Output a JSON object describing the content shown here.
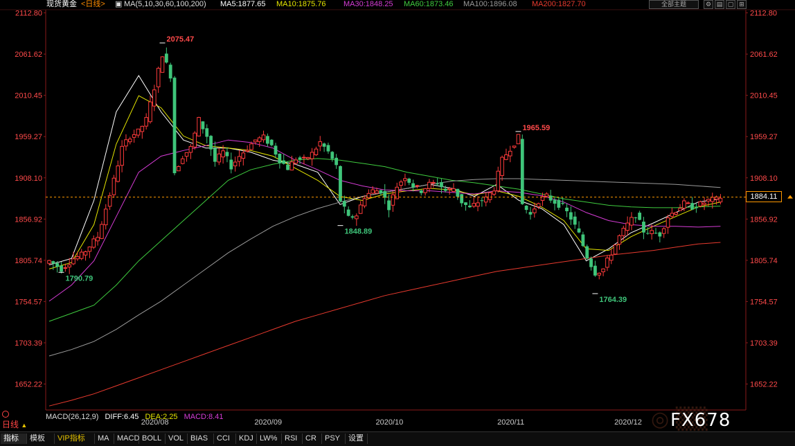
{
  "header": {
    "instrument": "现货黄金",
    "period_tag": "<日线>",
    "ma_group": "MA(5,10,30,60,100,200)",
    "ma5": "MA5:1877.65",
    "ma10": "MA10:1875.76",
    "ma30": "MA30:1848.25",
    "ma60": "MA60:1873.46",
    "ma100": "MA100:1896.08",
    "ma200": "MA200:1827.70",
    "all_button": "全部主题"
  },
  "colors": {
    "up": "#ff3b3b",
    "down": "#3fc57a",
    "ma5": "#ffffff",
    "ma10": "#e6e600",
    "ma30": "#d63cd6",
    "ma60": "#3fcc3f",
    "ma100": "#9a9a9a",
    "ma200": "#e83a2e",
    "price_line": "#ff9900"
  },
  "price_tag": "1884.11",
  "macd": {
    "title": "MACD(26,12,9)",
    "diff": "DIFF:6.45",
    "dea": "DEA:2.25",
    "macd": "MACD:8.41"
  },
  "period_label": "日线",
  "toolbar": [
    "指标",
    "模板",
    "VIP指标",
    "MA",
    "MACD",
    "BOLL",
    "VOL",
    "BIAS",
    "CCI",
    "KDJ",
    "LW%",
    "RSI",
    "CR",
    "PSY",
    "设置"
  ],
  "watermark": "FX678",
  "chart_data": {
    "type": "candlestick",
    "title": "",
    "ylim": [
      1620,
      2115
    ],
    "y_ticks": [
      "2112.80",
      "2061.62",
      "2010.45",
      "1959.27",
      "1908.10",
      "1856.92",
      "1805.74",
      "1754.57",
      "1703.39",
      "1652.22"
    ],
    "x_labels": [
      "2020/08",
      "2020/09",
      "2020/10",
      "2020/11",
      "2020/12"
    ],
    "annotations": [
      {
        "text": "2075.47",
        "index": 28,
        "value": 2075.47,
        "type": "high"
      },
      {
        "text": "1965.59",
        "index": 116,
        "value": 1965.59,
        "type": "high"
      },
      {
        "text": "1848.89",
        "index": 72,
        "value": 1848.89,
        "type": "low"
      },
      {
        "text": "1790.79",
        "index": 3,
        "value": 1790.79,
        "type": "low"
      },
      {
        "text": "1764.39",
        "index": 135,
        "value": 1764.39,
        "type": "low"
      }
    ],
    "current_price": 1884.11,
    "anchors": [
      [
        0,
        1805
      ],
      [
        3,
        1795
      ],
      [
        6,
        1808
      ],
      [
        8,
        1812
      ],
      [
        12,
        1835
      ],
      [
        14,
        1870
      ],
      [
        16,
        1905
      ],
      [
        18,
        1945
      ],
      [
        20,
        1960
      ],
      [
        22,
        1965
      ],
      [
        24,
        1980
      ],
      [
        26,
        2020
      ],
      [
        28,
        2062
      ],
      [
        30,
        2035
      ],
      [
        31,
        1915
      ],
      [
        33,
        1935
      ],
      [
        35,
        1945
      ],
      [
        37,
        1980
      ],
      [
        39,
        1960
      ],
      [
        41,
        1928
      ],
      [
        43,
        1940
      ],
      [
        45,
        1922
      ],
      [
        47,
        1935
      ],
      [
        49,
        1945
      ],
      [
        51,
        1955
      ],
      [
        53,
        1958
      ],
      [
        55,
        1948
      ],
      [
        57,
        1930
      ],
      [
        59,
        1920
      ],
      [
        61,
        1932
      ],
      [
        63,
        1930
      ],
      [
        65,
        1938
      ],
      [
        67,
        1952
      ],
      [
        69,
        1940
      ],
      [
        71,
        1922
      ],
      [
        72,
        1880
      ],
      [
        74,
        1858
      ],
      [
        76,
        1862
      ],
      [
        78,
        1885
      ],
      [
        80,
        1892
      ],
      [
        82,
        1892
      ],
      [
        84,
        1872
      ],
      [
        86,
        1898
      ],
      [
        88,
        1910
      ],
      [
        90,
        1898
      ],
      [
        92,
        1892
      ],
      [
        94,
        1900
      ],
      [
        96,
        1902
      ],
      [
        98,
        1892
      ],
      [
        100,
        1895
      ],
      [
        102,
        1878
      ],
      [
        104,
        1870
      ],
      [
        106,
        1878
      ],
      [
        108,
        1882
      ],
      [
        110,
        1895
      ],
      [
        112,
        1930
      ],
      [
        114,
        1945
      ],
      [
        116,
        1958
      ],
      [
        117,
        1875
      ],
      [
        119,
        1862
      ],
      [
        121,
        1880
      ],
      [
        123,
        1885
      ],
      [
        125,
        1878
      ],
      [
        127,
        1872
      ],
      [
        129,
        1858
      ],
      [
        131,
        1838
      ],
      [
        133,
        1810
      ],
      [
        135,
        1790
      ],
      [
        137,
        1795
      ],
      [
        139,
        1815
      ],
      [
        141,
        1835
      ],
      [
        143,
        1850
      ],
      [
        145,
        1862
      ],
      [
        147,
        1842
      ],
      [
        149,
        1840
      ],
      [
        151,
        1838
      ],
      [
        153,
        1860
      ],
      [
        155,
        1868
      ],
      [
        157,
        1876
      ],
      [
        159,
        1872
      ],
      [
        161,
        1875
      ],
      [
        163,
        1880
      ],
      [
        165,
        1881
      ],
      [
        166,
        1884
      ]
    ],
    "ma_series": [
      {
        "name": "MA5",
        "values": [
          1800,
          1808,
          1880,
          1990,
          2035,
          1990,
          1955,
          1945,
          1945,
          1940,
          1930,
          1925,
          1915,
          1875,
          1885,
          1890,
          1895,
          1900,
          1895,
          1885,
          1900,
          1880,
          1870,
          1850,
          1805,
          1820,
          1840,
          1852,
          1865,
          1878,
          1882
        ]
      },
      {
        "name": "MA10",
        "values": [
          1795,
          1803,
          1850,
          1950,
          2010,
          1995,
          1960,
          1948,
          1945,
          1942,
          1935,
          1920,
          1905,
          1885,
          1880,
          1888,
          1892,
          1895,
          1893,
          1887,
          1892,
          1885,
          1872,
          1855,
          1820,
          1818,
          1835,
          1848,
          1860,
          1872,
          1878
        ]
      },
      {
        "name": "MA30",
        "values": [
          1755,
          1775,
          1805,
          1860,
          1915,
          1935,
          1942,
          1948,
          1955,
          1952,
          1945,
          1930,
          1918,
          1905,
          1898,
          1893,
          1892,
          1892,
          1890,
          1888,
          1892,
          1890,
          1886,
          1878,
          1865,
          1855,
          1850,
          1848,
          1848,
          1847,
          1848
        ]
      },
      {
        "name": "MA60",
        "values": [
          1730,
          1740,
          1750,
          1775,
          1805,
          1830,
          1855,
          1880,
          1905,
          1918,
          1925,
          1930,
          1932,
          1930,
          1926,
          1922,
          1915,
          1910,
          1905,
          1902,
          1898,
          1894,
          1888,
          1882,
          1878,
          1874,
          1872,
          1871,
          1871,
          1872,
          1873
        ]
      },
      {
        "name": "MA100",
        "values": [
          1687,
          1695,
          1705,
          1720,
          1738,
          1755,
          1775,
          1795,
          1815,
          1832,
          1848,
          1860,
          1870,
          1878,
          1885,
          1890,
          1895,
          1900,
          1904,
          1906,
          1907,
          1907,
          1906,
          1905,
          1904,
          1903,
          1902,
          1901,
          1900,
          1898,
          1896
        ]
      },
      {
        "name": "MA200",
        "values": [
          1625,
          1632,
          1640,
          1650,
          1660,
          1670,
          1680,
          1690,
          1700,
          1710,
          1720,
          1730,
          1738,
          1746,
          1754,
          1762,
          1768,
          1774,
          1780,
          1786,
          1792,
          1796,
          1800,
          1804,
          1808,
          1812,
          1815,
          1818,
          1822,
          1826,
          1828
        ]
      }
    ]
  }
}
